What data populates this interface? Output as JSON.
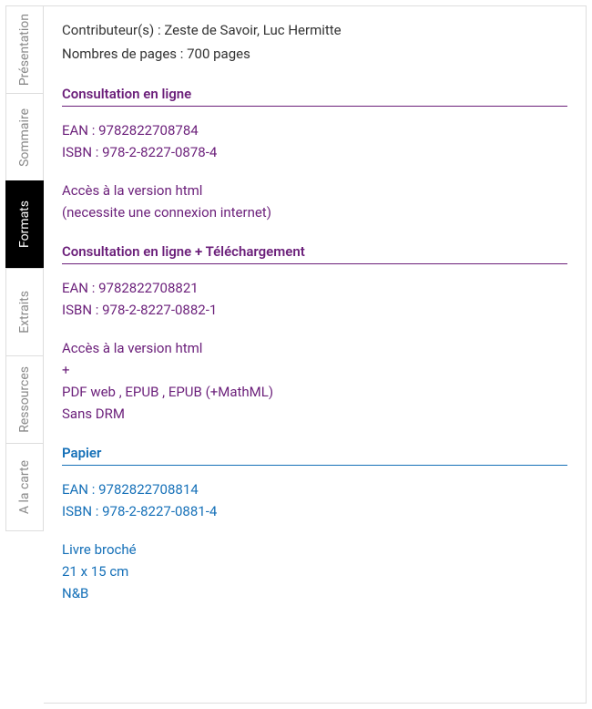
{
  "tabs": [
    {
      "label": "Présentation"
    },
    {
      "label": "Sommaire"
    },
    {
      "label": "Formats"
    },
    {
      "label": "Extraits"
    },
    {
      "label": "Ressources"
    },
    {
      "label": "A la carte"
    }
  ],
  "meta": {
    "contributors": "Contributeur(s) : Zeste de Savoir, Luc Hermitte",
    "pages": "Nombres de pages : 700 pages"
  },
  "numerique_online": {
    "title": "Consultation en ligne",
    "ean": "EAN : 9782822708784",
    "isbn": "ISBN : 978-2-8227-0878-4",
    "access_line1": "Accès à la version html",
    "access_line2": "(necessite une connexion internet)"
  },
  "numerique_download": {
    "title": "Consultation en ligne + Téléchargement",
    "ean": "EAN : 9782822708821",
    "isbn": "ISBN : 978-2-8227-0882-1",
    "access_line1": "Accès à la version html",
    "access_line2": "+",
    "access_line3": "PDF web , EPUB , EPUB (+MathML)",
    "access_line4": "Sans DRM"
  },
  "papier": {
    "title": "Papier",
    "ean": "EAN : 9782822708814",
    "isbn": "ISBN : 978-2-8227-0881-4",
    "detail_line1": "Livre broché",
    "detail_line2": "21 x 15 cm",
    "detail_line3": "N&B"
  }
}
